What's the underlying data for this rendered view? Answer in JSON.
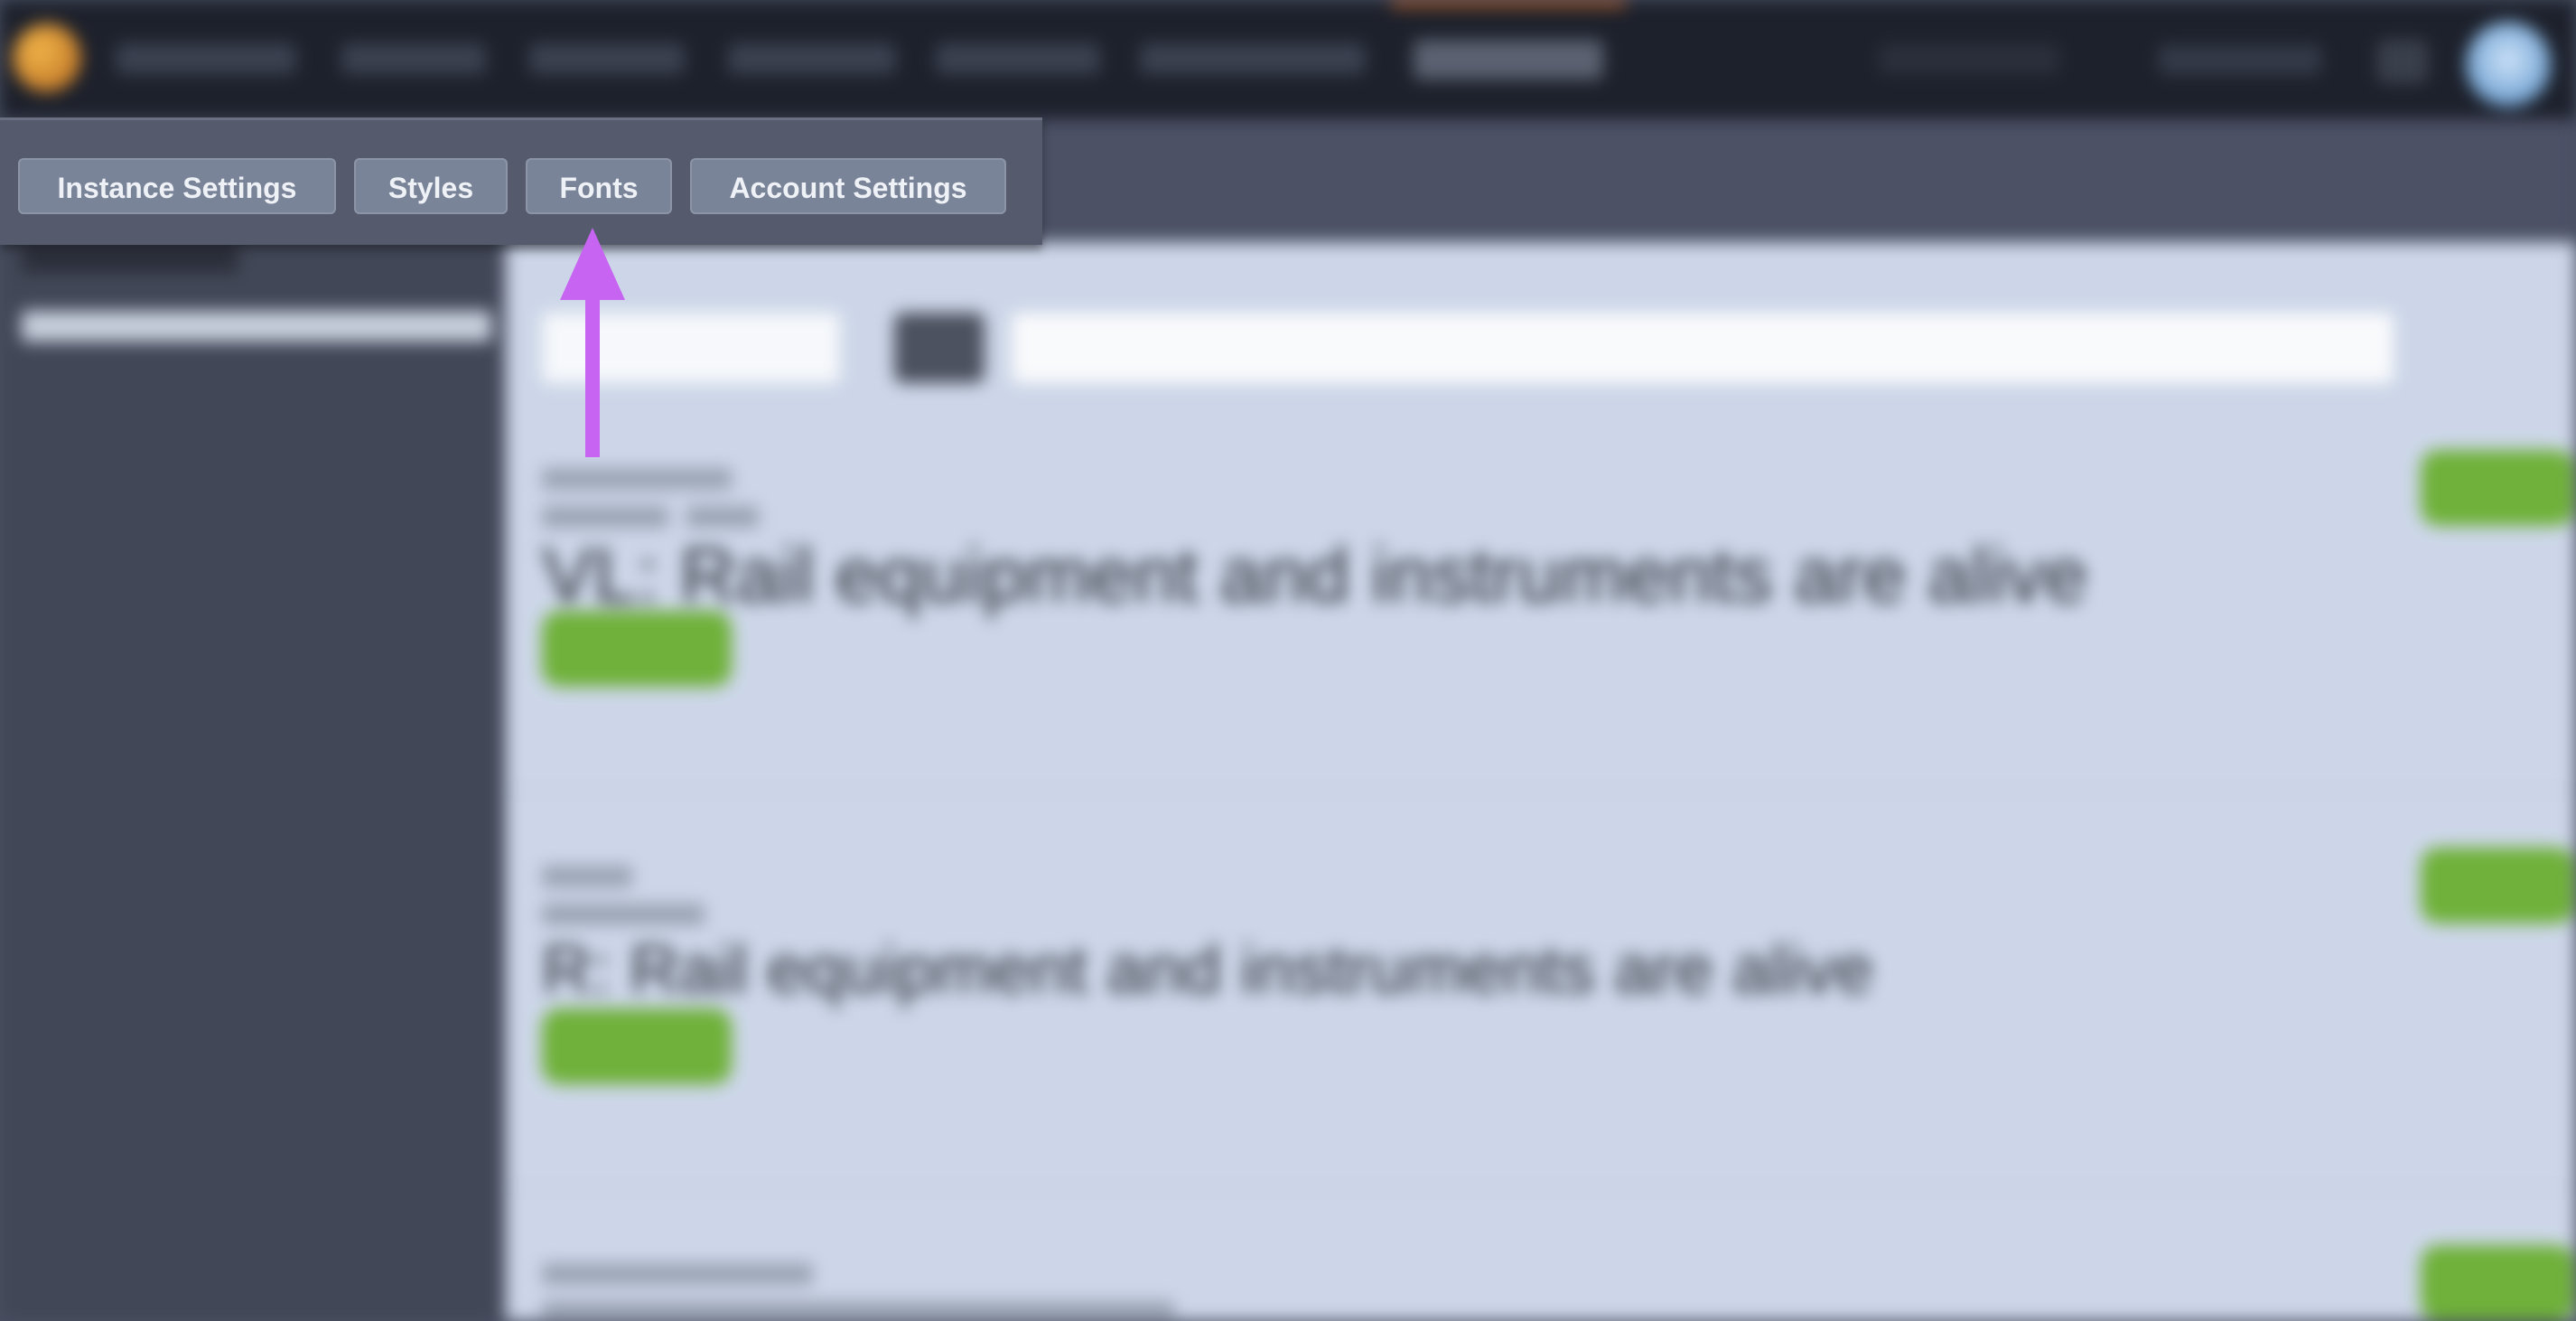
{
  "settings_menu": {
    "items": [
      {
        "label": "Instance Settings"
      },
      {
        "label": "Styles"
      },
      {
        "label": "Fonts"
      },
      {
        "label": "Account Settings"
      }
    ]
  },
  "background_content": {
    "preview_texts": [
      "VL: Rail equipment and instruments are alive",
      "R: Rail equipment and instruments are alive"
    ]
  },
  "colors": {
    "menu_button_bg": "#7a8499",
    "panel_bg": "#555b6c",
    "arrow": "#c765f2",
    "accent_green": "#6fb13a",
    "topbar_bg": "#1d212c",
    "main_bg": "#ccd6e8"
  },
  "annotation": {
    "icon": "arrow-up-icon"
  }
}
